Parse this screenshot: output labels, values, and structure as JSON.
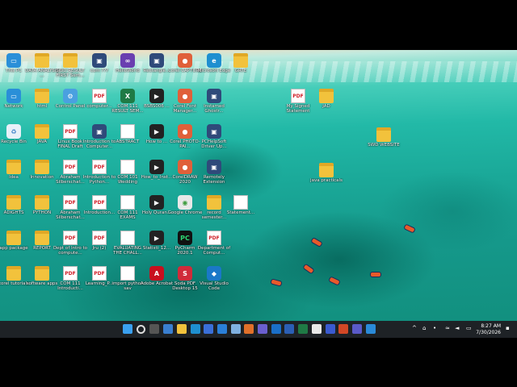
{
  "desktop": {
    "icons": [
      {
        "label": "This PC",
        "kind": "pc"
      },
      {
        "label": "DATA ANALYSIS ...",
        "kind": "folder"
      },
      {
        "label": "SWD RESULT FIRST Sem...",
        "kind": "folder"
      },
      {
        "label": "cum ???",
        "kind": "app"
      },
      {
        "label": "HelloWorld",
        "kind": "vs"
      },
      {
        "label": "Rectangle...",
        "kind": "app"
      },
      {
        "label": "Corel CAPTURE",
        "kind": "corel"
      },
      {
        "label": "Microsoft Edge",
        "kind": "edge"
      },
      {
        "label": "GRTE",
        "kind": "folder"
      },
      {
        "label": "Network",
        "kind": "pc"
      },
      {
        "label": "html",
        "kind": "folder"
      },
      {
        "label": "Control Panel",
        "kind": "cp"
      },
      {
        "label": "computer...",
        "kind": "pdf"
      },
      {
        "label": "COM 111 RESULT SEM...",
        "kind": "excel"
      },
      {
        "label": "BSBS006 ...",
        "kind": "video"
      },
      {
        "label": "Corel Font Manager...",
        "kind": "corel"
      },
      {
        "label": "Instamed Ghostr...",
        "kind": "app"
      },
      {
        "label": "My Signed Statement",
        "kind": "pdf"
      },
      {
        "label": "JAD",
        "kind": "folder"
      },
      {
        "label": "Recycle Bin",
        "kind": "bin"
      },
      {
        "label": "JAVA",
        "kind": "folder"
      },
      {
        "label": "Linux Book FINAL Draft",
        "kind": "pdf"
      },
      {
        "label": "Introduction to Computer...",
        "kind": "app"
      },
      {
        "label": "ABSTRACT",
        "kind": "doc"
      },
      {
        "label": "How to ...",
        "kind": "video"
      },
      {
        "label": "Corel PHOTO-PAI...",
        "kind": "corel"
      },
      {
        "label": "PCHelpSoft Driver Up...",
        "kind": "app"
      },
      {
        "label": "SWD WEBSITE",
        "kind": "folder"
      },
      {
        "label": "Idea",
        "kind": "folder"
      },
      {
        "label": "Innovation",
        "kind": "folder"
      },
      {
        "label": "Abraham Silberschat...",
        "kind": "pdf"
      },
      {
        "label": "Introduction to Python...",
        "kind": "pdf"
      },
      {
        "label": "COM 101 Wedding",
        "kind": "doc"
      },
      {
        "label": "How_to_Inst...",
        "kind": "video"
      },
      {
        "label": "CorelDRAW 2020",
        "kind": "corel"
      },
      {
        "label": "Remotely Extension",
        "kind": "app"
      },
      {
        "label": "java practicals",
        "kind": "folder"
      },
      {
        "label": "ADIGHTS",
        "kind": "folder"
      },
      {
        "label": "PYTHON",
        "kind": "folder"
      },
      {
        "label": "Abraham Silberschat...",
        "kind": "pdf"
      },
      {
        "label": "Introduction...",
        "kind": "pdf"
      },
      {
        "label": "COM 111 EXAMS",
        "kind": "doc"
      },
      {
        "label": "Holy Quran...",
        "kind": "video"
      },
      {
        "label": "Google Chrome",
        "kind": "chrome"
      },
      {
        "label": "record semester...",
        "kind": "folder"
      },
      {
        "label": "Statement...",
        "kind": "doc"
      },
      {
        "label": "app package",
        "kind": "folder"
      },
      {
        "label": "REPORT",
        "kind": "folder"
      },
      {
        "label": "Dept of Intro to compute...",
        "kind": "pdf"
      },
      {
        "label": "Jru (2)",
        "kind": "pdf"
      },
      {
        "label": "EVALUATING THE CHALL...",
        "kind": "doc"
      },
      {
        "label": "Statisti_12...",
        "kind": "video"
      },
      {
        "label": "PyCharm 2020.1",
        "kind": "pycharm"
      },
      {
        "label": "Department of Comput...",
        "kind": "pdf"
      },
      {
        "label": "corel tutorials",
        "kind": "folder"
      },
      {
        "label": "software apps",
        "kind": "folder"
      },
      {
        "label": "COM 111 Introducti...",
        "kind": "pdf"
      },
      {
        "label": "Learning_P...",
        "kind": "pdf"
      },
      {
        "label": "import python sav",
        "kind": "doc"
      },
      {
        "label": "Adobe Acrobat",
        "kind": "acrobat"
      },
      {
        "label": "Soda PDF Desktop 15",
        "kind": "soda"
      },
      {
        "label": "Visual Studio Code",
        "kind": "vscode"
      }
    ]
  },
  "taskbar": {
    "apps": [
      "start",
      "search",
      "task-view",
      "widgets",
      "file-explorer",
      "edge",
      "store",
      "mail",
      "notepad",
      "sublime",
      "teams-chat",
      "outlook",
      "word",
      "excel",
      "chrome",
      "shield",
      "powerpoint",
      "teams",
      "snipping"
    ],
    "time": "8:27 AM",
    "date": "7/30/2026"
  }
}
